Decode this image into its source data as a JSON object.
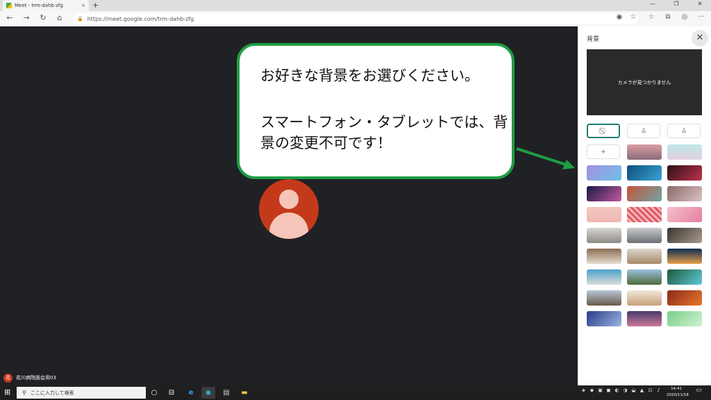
{
  "browser": {
    "tab_title": "Meet - trm-dahb-zfg",
    "tab_close": "×",
    "new_tab": "+",
    "win_min": "—",
    "win_max": "❐",
    "win_close": "✕",
    "back": "←",
    "forward": "→",
    "reload": "↻",
    "home": "⌂",
    "url": "https://meet.google.com/trm-dahb-zfg",
    "lock": "🔒",
    "toolbar": [
      "◉",
      "☆",
      "☆",
      "⧉",
      "◎",
      "···"
    ]
  },
  "callout": {
    "line1": "お好きな背景をお選びください。",
    "line2": "スマートフォン・タブレットでは、背",
    "line3": "景の変更不可です！",
    "border_color": "#1e9e43"
  },
  "panel": {
    "title": "背景",
    "close": "✕",
    "preview_text": "カメラが見つかりません",
    "options": {
      "none": "⃠",
      "blur_light": "♙",
      "blur_strong": "♙",
      "add": "+"
    },
    "backgrounds": [
      {
        "name": "bg-pink-horizon",
        "bg": "linear-gradient(#d9a0a5,#8a6a7a)"
      },
      {
        "name": "bg-mint-sky",
        "bg": "linear-gradient(#bfe8e8,#e2cfe0)"
      },
      {
        "name": "bg-lavender-galaxy",
        "bg": "linear-gradient(135deg,#a58fe0,#6fc1e8)"
      },
      {
        "name": "bg-blue-particles",
        "bg": "linear-gradient(135deg,#0e4e7a,#3aa3d8)"
      },
      {
        "name": "bg-red-nebula",
        "bg": "linear-gradient(135deg,#2a1218,#c2304a)"
      },
      {
        "name": "bg-space-pink",
        "bg": "linear-gradient(135deg,#1a1848,#c05a9c)"
      },
      {
        "name": "bg-flowers-red",
        "bg": "linear-gradient(135deg,#c6533a,#6ea5a1)"
      },
      {
        "name": "bg-pebbles",
        "bg": "linear-gradient(135deg,#8a6a6a,#d8c2c0)"
      },
      {
        "name": "bg-pink-paper",
        "bg": "linear-gradient(#f3c6c0,#f0b7b2)"
      },
      {
        "name": "bg-red-pattern",
        "bg": "repeating-linear-gradient(45deg,#e05a66 0 3px,#f5b7bb 3px 6px)"
      },
      {
        "name": "bg-pink-flowers",
        "bg": "linear-gradient(135deg,#f7c0cc,#e67da0)"
      },
      {
        "name": "bg-grey-room",
        "bg": "linear-gradient(#d9d6d2,#8e8a86)"
      },
      {
        "name": "bg-white-office",
        "bg": "linear-gradient(#c9cbcf,#6c6f74)"
      },
      {
        "name": "bg-dark-studio",
        "bg": "linear-gradient(135deg,#3a3532,#a89a8a)"
      },
      {
        "name": "bg-bookshelf",
        "bg": "linear-gradient(#8a6d52,#e6dcd0)"
      },
      {
        "name": "bg-white-shelf",
        "bg": "linear-gradient(#dcd6cc,#a88a6a)"
      },
      {
        "name": "bg-night-pool",
        "bg": "linear-gradient(#0d2c52,#e6a04a)"
      },
      {
        "name": "bg-beach-house",
        "bg": "linear-gradient(#4aa3c8,#dcdcdc)"
      },
      {
        "name": "bg-mountains",
        "bg": "linear-gradient(#9ac0dc,#4c6a3a)"
      },
      {
        "name": "bg-tropical-beach",
        "bg": "linear-gradient(135deg,#1a5a3a,#60c8d8)"
      },
      {
        "name": "bg-village",
        "bg": "linear-gradient(#b8c8d8,#6a5a4a)"
      },
      {
        "name": "bg-bright-room",
        "bg": "linear-gradient(#f0e8dc,#c8a07a)"
      },
      {
        "name": "bg-autumn",
        "bg": "linear-gradient(135deg,#8a2a1a,#e8782a)"
      },
      {
        "name": "bg-blue-leaves",
        "bg": "linear-gradient(135deg,#2a3a8a,#9ab4e0)"
      },
      {
        "name": "bg-purple-city",
        "bg": "linear-gradient(#4a3a6a,#c87a9a)"
      },
      {
        "name": "bg-green-leaves",
        "bg": "linear-gradient(135deg,#7ad08a,#d0f0d0)"
      }
    ]
  },
  "participant": {
    "badge": "花",
    "name": "花川病院面会用03"
  },
  "taskbar": {
    "start": "⊞",
    "search_icon": "⚲",
    "search_placeholder": "ここに入力して検索",
    "apps": [
      "○",
      "⊟",
      "e",
      "◉",
      "▤",
      "▬"
    ],
    "tray": [
      "◈",
      "◆",
      "▣",
      "◼",
      "◐",
      "◑",
      "◒",
      "▲",
      "⊡",
      "♪"
    ],
    "time": "14:41",
    "date": "2020/11/18",
    "notif": "▭"
  }
}
